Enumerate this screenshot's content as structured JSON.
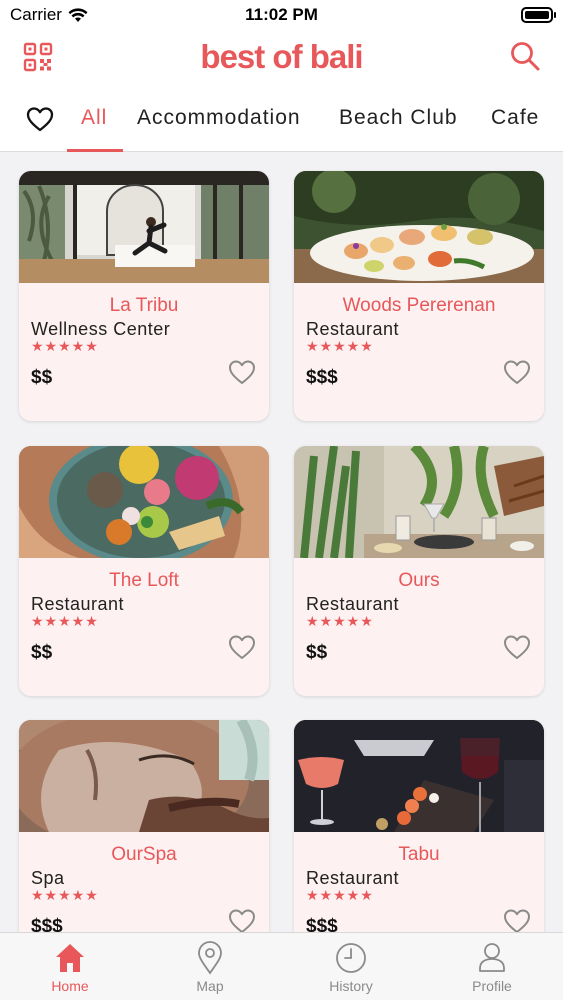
{
  "status_bar": {
    "carrier": "Carrier",
    "time": "11:02 PM"
  },
  "header": {
    "logo": "best of bali",
    "left_icon": "qr-code-icon",
    "right_icon": "search-icon"
  },
  "tabs": {
    "favorites_icon": "heart-icon",
    "items": [
      {
        "label": "All",
        "active": true
      },
      {
        "label": "Accommodation",
        "active": false
      },
      {
        "label": "Beach Club",
        "active": false
      },
      {
        "label": "Cafe",
        "active": false
      }
    ]
  },
  "accent_color": "#e8585a",
  "listings": [
    {
      "name": "La Tribu",
      "category": "Wellness Center",
      "rating": 5,
      "stars": "★★★★★",
      "price": "$$"
    },
    {
      "name": "Woods Pererenan",
      "category": "Restaurant",
      "rating": 5,
      "stars": "★★★★★",
      "price": "$$$"
    },
    {
      "name": "The Loft",
      "category": "Restaurant",
      "rating": 5,
      "stars": "★★★★★",
      "price": "$$"
    },
    {
      "name": "Ours",
      "category": "Restaurant",
      "rating": 5,
      "stars": "★★★★★",
      "price": "$$"
    },
    {
      "name": "OurSpa",
      "category": "Spa",
      "rating": 5,
      "stars": "★★★★★",
      "price": "$$$"
    },
    {
      "name": "Tabu",
      "category": "Restaurant",
      "rating": 5,
      "stars": "★★★★★",
      "price": "$$$"
    }
  ],
  "tab_bar": {
    "items": [
      {
        "label": "Home",
        "icon": "home-icon",
        "active": true
      },
      {
        "label": "Map",
        "icon": "map-pin-icon",
        "active": false
      },
      {
        "label": "History",
        "icon": "clock-icon",
        "active": false
      },
      {
        "label": "Profile",
        "icon": "person-icon",
        "active": false
      }
    ]
  }
}
